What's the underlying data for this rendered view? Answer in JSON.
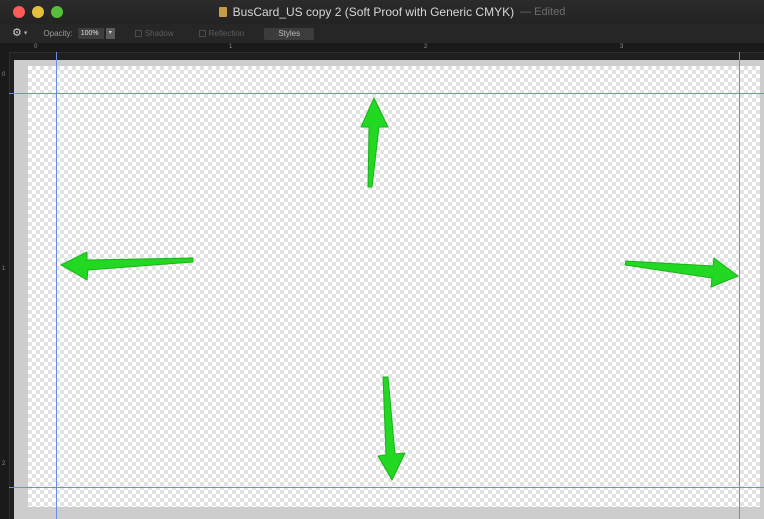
{
  "window": {
    "title": "BusCard_US copy 2 (Soft Proof with Generic CMYK)",
    "status": "— Edited"
  },
  "toolbar": {
    "opacity_label": "Opacity:",
    "opacity_value": "100%",
    "shadow_label": "Shadow",
    "reflection_label": "Reflection",
    "styles_label": "Styles"
  },
  "rulers": {
    "top_ticks": [
      "0",
      "1",
      "2",
      "3"
    ],
    "left_ticks": [
      "0",
      "1",
      "2"
    ]
  },
  "canvas": {
    "background": "transparent-checkerboard",
    "guide_color": "#6b8de6",
    "annotation_color": "#22d822",
    "annotations": [
      "arrow-up-annotation",
      "arrow-left-annotation",
      "arrow-right-annotation",
      "arrow-down-annotation"
    ]
  }
}
